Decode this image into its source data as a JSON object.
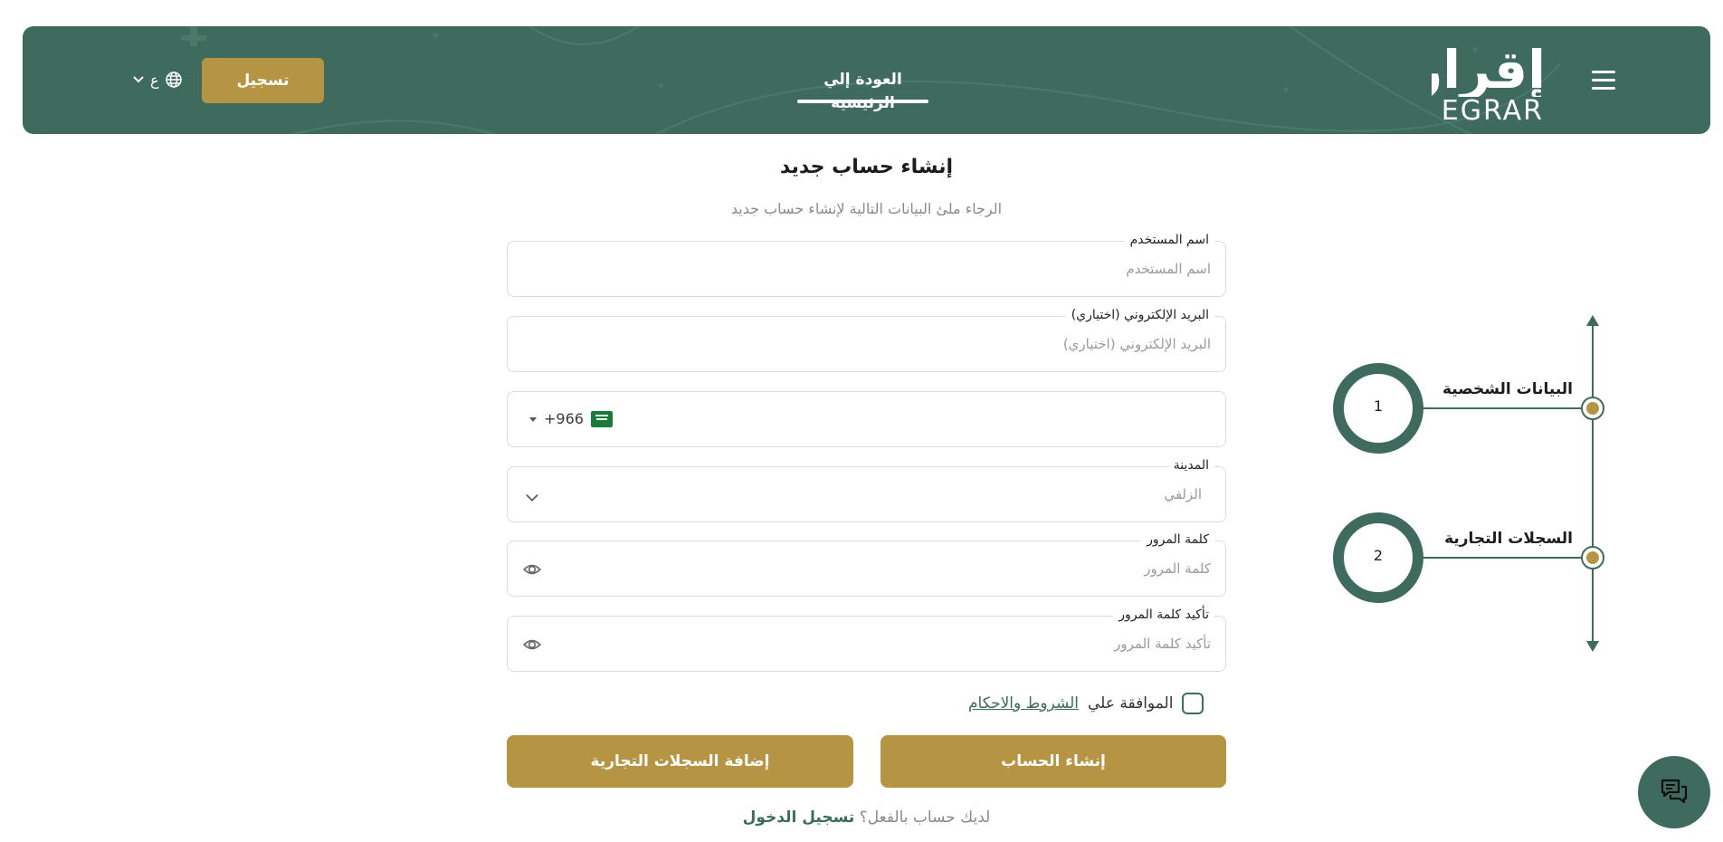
{
  "header": {
    "logo_arabic": "إقرار",
    "logo_english": "EGRAR",
    "nav_home": "العودة إلي الرئيسية",
    "register_label": "تسجيل",
    "language": "ع",
    "menu_icon": "hamburger-icon",
    "language_icon": "globe-icon"
  },
  "stepper": {
    "steps": [
      {
        "number": "1",
        "label": "البيانات الشخصية"
      },
      {
        "number": "2",
        "label": "السجلات التجارية"
      }
    ]
  },
  "form": {
    "title": "إنشاء حساب جديد",
    "subtitle": "الرجاء ملئ البيانات التالية لإنشاء حساب جديد",
    "username": {
      "label": "اسم المستخدم",
      "placeholder": "اسم المستخدم"
    },
    "email": {
      "label": "البريد الإلكتروني (اختياري)",
      "placeholder": "البريد الإلكتروني (اختياري)"
    },
    "phone": {
      "country_code": "+966"
    },
    "city": {
      "label": "المدينة",
      "value": "الزلفي"
    },
    "password": {
      "label": "كلمة المرور",
      "placeholder": "كلمة المرور"
    },
    "confirm_password": {
      "label": "تأكيد كلمة المرور",
      "placeholder": "تأكيد كلمة المرور"
    },
    "agree_prefix": "الموافقة علي",
    "agree_link": "الشروط والاحكام",
    "create_account": "إنشاء الحساب",
    "add_records": "إضافة السجلات التجارية",
    "have_account": "لديك حساب بالفعل؟",
    "login_link": "تسجيل الدخول"
  },
  "colors": {
    "primary": "#3e6b5d",
    "gold": "#b59443"
  }
}
